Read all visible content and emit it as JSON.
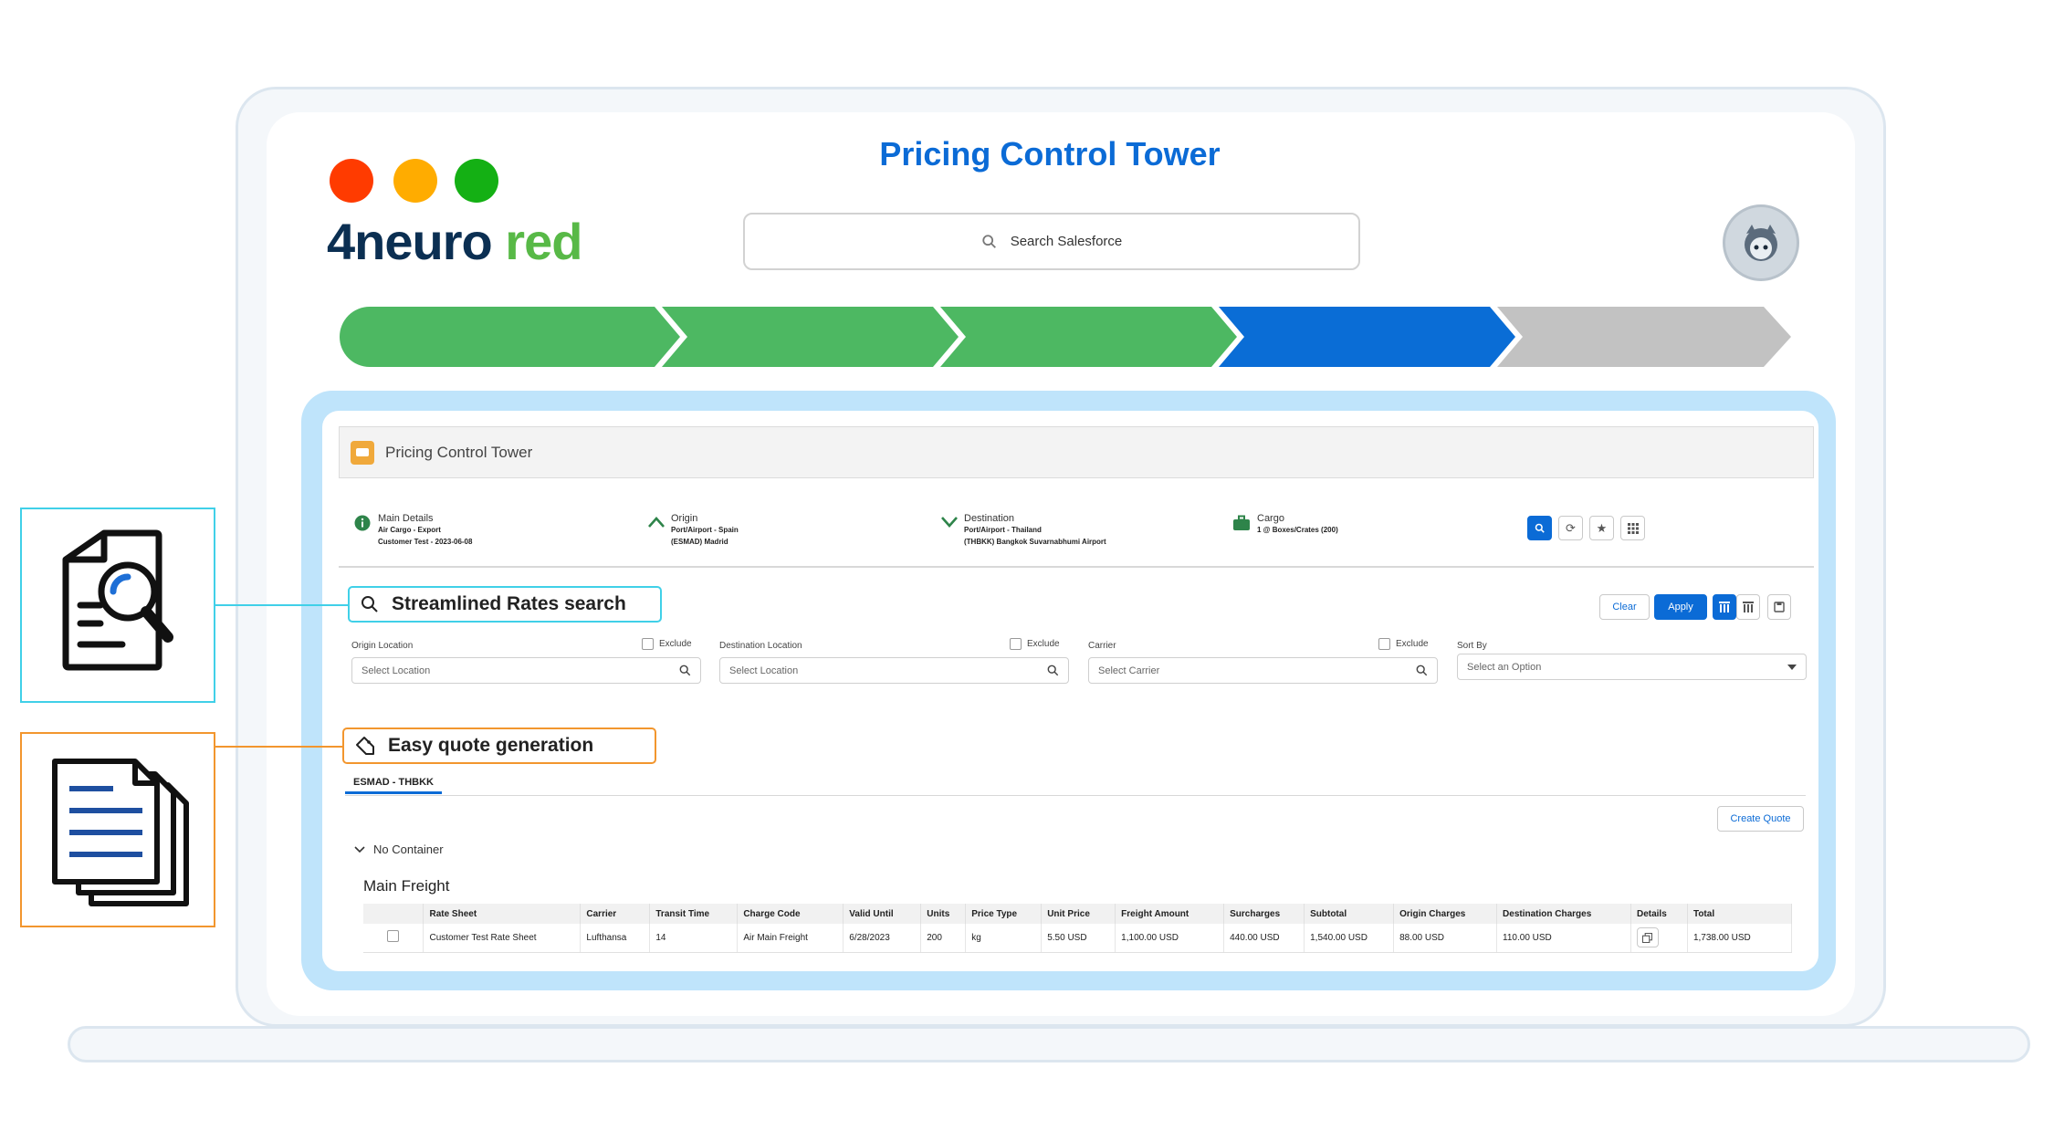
{
  "app": {
    "title": "Pricing Control Tower",
    "logo": {
      "part1": "neuro",
      "part2": "red",
      "mark": "4"
    },
    "window_dots": [
      "#ff3b00",
      "#ffac00",
      "#14b014"
    ],
    "search_placeholder": "Search Salesforce"
  },
  "progress_steps": [
    {
      "status": "complete",
      "color": "#4db862"
    },
    {
      "status": "complete",
      "color": "#4db862"
    },
    {
      "status": "complete",
      "color": "#4db862"
    },
    {
      "status": "current",
      "color": "#0a6dd6"
    },
    {
      "status": "upcoming",
      "color": "#c2c2c2"
    }
  ],
  "panel": {
    "header_title": "Pricing Control Tower",
    "summary": {
      "main_details": {
        "title": "Main Details",
        "line1": "Air Cargo - Export",
        "line2": "Customer Test - 2023-06-08"
      },
      "origin": {
        "title": "Origin",
        "line1": "Port/Airport - Spain",
        "line2": "(ESMAD) Madrid"
      },
      "destination": {
        "title": "Destination",
        "line1": "Port/Airport - Thailand",
        "line2": "(THBKK) Bangkok Suvarnabhumi Airport"
      },
      "cargo": {
        "title": "Cargo",
        "line1": "1 @ Boxes/Crates (200)"
      }
    }
  },
  "callouts": {
    "search": {
      "label": "Streamlined Rates search",
      "color": "#40d0e8"
    },
    "quote": {
      "label": "Easy quote generation",
      "color": "#f2962e"
    }
  },
  "filters": {
    "origin": {
      "label": "Origin Location",
      "exclude": "Exclude",
      "placeholder": "Select Location"
    },
    "destination": {
      "label": "Destination Location",
      "exclude": "Exclude",
      "placeholder": "Select Location"
    },
    "carrier": {
      "label": "Carrier",
      "exclude": "Exclude",
      "placeholder": "Select Carrier"
    },
    "sort": {
      "label": "Sort By",
      "placeholder": "Select an Option"
    },
    "clear_label": "Clear",
    "apply_label": "Apply"
  },
  "results": {
    "tab_label": "ESMAD - THBKK",
    "create_quote_label": "Create Quote",
    "group_label": "No Container",
    "section_title": "Main Freight",
    "columns": [
      "",
      "Rate Sheet",
      "Carrier",
      "Transit Time",
      "Charge Code",
      "Valid Until",
      "Units",
      "Price Type",
      "Unit Price",
      "Freight Amount",
      "Surcharges",
      "Subtotal",
      "Origin Charges",
      "Destination Charges",
      "Details",
      "Total"
    ],
    "rows": [
      [
        "",
        "Customer Test Rate Sheet",
        "Lufthansa",
        "14",
        "Air Main Freight",
        "6/28/2023",
        "200",
        "kg",
        "5.50 USD",
        "1,100.00 USD",
        "440.00 USD",
        "1,540.00 USD",
        "88.00 USD",
        "110.00 USD",
        "",
        "1,738.00 USD"
      ]
    ]
  }
}
